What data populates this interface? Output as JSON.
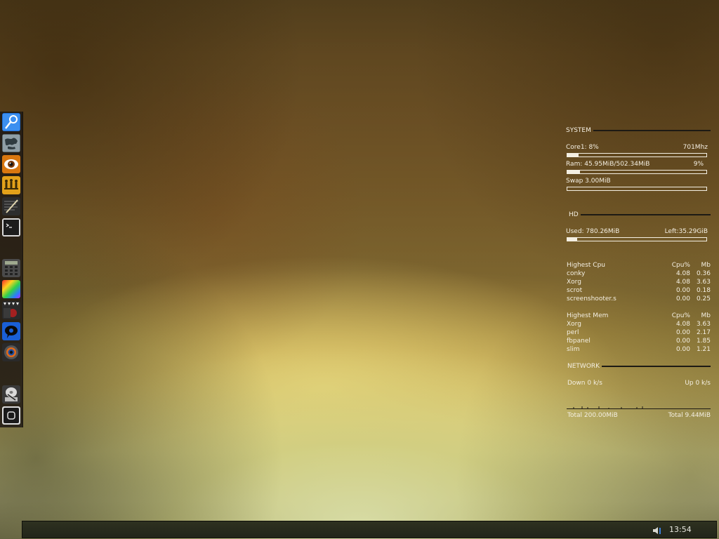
{
  "dock": {
    "icons": [
      {
        "name": "search-icon"
      },
      {
        "name": "globe-icon"
      },
      {
        "name": "eye-icon"
      },
      {
        "name": "people-icon"
      },
      {
        "name": "text-editor-icon"
      },
      {
        "name": "terminal-icon"
      },
      {
        "name": "calculator-icon"
      },
      {
        "name": "color-palette-icon"
      },
      {
        "name": "media-player-icon"
      },
      {
        "name": "chat-icon"
      },
      {
        "name": "camera-icon"
      },
      {
        "name": "disk-utility-icon"
      },
      {
        "name": "power-icon"
      }
    ]
  },
  "conky": {
    "system": {
      "heading": "SYSTEM",
      "cpu_label": "Core1: 8%",
      "cpu_freq": "701Mhz",
      "cpu_percent": 8,
      "ram_label": "Ram:  45.95MiB/502.34MiB",
      "ram_percent_label": "9%",
      "ram_percent": 9,
      "swap_label": "Swap 3.00MiB",
      "swap_percent": 0
    },
    "hd": {
      "heading": "HD",
      "used_label": "Used: 780.26MiB",
      "left_label": "Left:35.29GiB",
      "used_percent": 7
    },
    "top_cpu": {
      "heading": "Highest Cpu",
      "col_cpu": "Cpu%",
      "col_mb": "Mb",
      "rows": [
        {
          "name": "conky",
          "cpu": "4.08",
          "mb": "0.36"
        },
        {
          "name": "Xorg",
          "cpu": "4.08",
          "mb": "3.63"
        },
        {
          "name": "scrot",
          "cpu": "0.00",
          "mb": "0.18"
        },
        {
          "name": "screenshooter.s",
          "cpu": "0.00",
          "mb": "0.25"
        }
      ]
    },
    "top_mem": {
      "heading": "Highest Mem",
      "col_cpu": "Cpu%",
      "col_mb": "Mb",
      "rows": [
        {
          "name": "Xorg",
          "cpu": "4.08",
          "mb": "3.63"
        },
        {
          "name": "perl",
          "cpu": "0.00",
          "mb": "2.17"
        },
        {
          "name": "fbpanel",
          "cpu": "0.00",
          "mb": "1.85"
        },
        {
          "name": "slim",
          "cpu": "0.00",
          "mb": "1.21"
        }
      ]
    },
    "network": {
      "heading": "NETWORK",
      "down_label": "Down 0 k/s",
      "up_label": "Up 0 k/s",
      "total_down": "Total 200.00MiB",
      "total_up": "Total 9.44MiB"
    }
  },
  "panel": {
    "volume_icon": "speaker-icon",
    "clock": "13:54"
  }
}
